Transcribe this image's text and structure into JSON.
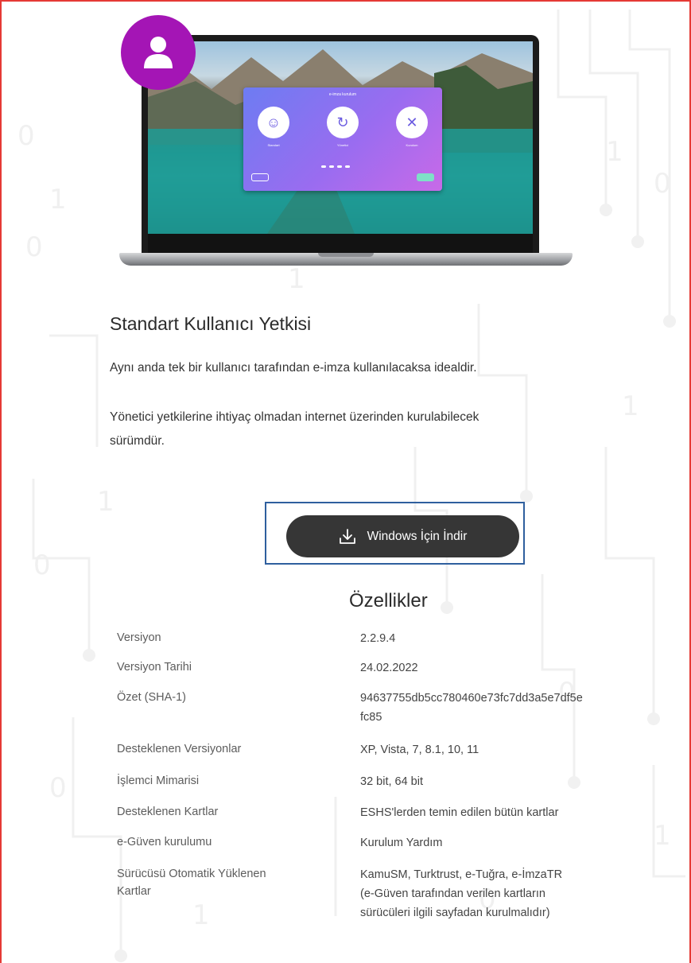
{
  "hero": {
    "avatar_icon": "user-icon",
    "app_window_title": "e-imza kurulum",
    "app_cards": [
      "Standart",
      "Yönetici",
      "Kurulum"
    ]
  },
  "section": {
    "title": "Standart Kullanıcı Yetkisi",
    "paragraph_1": "Aynı anda tek bir kullanıcı tarafından e-imza kullanılacaksa idealdir.",
    "paragraph_2_line_1": "Yönetici yetkilerine ihtiyaç olmadan internet üzerinden kurulabilecek",
    "paragraph_2_line_2": "sürümdür."
  },
  "download": {
    "icon": "download-icon",
    "label": "Windows İçin İndir"
  },
  "features": {
    "title": "Özellikler",
    "rows": [
      {
        "label": "Versiyon",
        "value": "2.2.9.4"
      },
      {
        "label": "Versiyon Tarihi",
        "value": "24.02.2022"
      },
      {
        "label": "Özet (SHA-1)",
        "value": "94637755db5cc780460e73fc7dd3a5e7df5e",
        "value_2": "fc85"
      },
      {
        "label": "Desteklenen Versiyonlar",
        "value": "XP, Vista, 7, 8.1, 10, 11"
      },
      {
        "label": "İşlemci Mimarisi",
        "value": "32 bit, 64 bit"
      },
      {
        "label": "Desteklenen Kartlar",
        "value": "ESHS'lerden temin edilen bütün kartlar"
      },
      {
        "label": "e-Güven kurulumu",
        "value": "Kurulum Yardım"
      },
      {
        "label": "Sürücüsü Otomatik Yüklenen",
        "label_2": "Kartlar",
        "value": "KamuSM, Turktrust, e-Tuğra, e-İmzaTR",
        "value_2": "(e-Güven tarafından verilen kartların",
        "value_3": "sürücüleri ilgili sayfadan kurulmalıdır)"
      }
    ]
  },
  "colors": {
    "frame_border": "#e53935",
    "avatar_bg": "#a415b5",
    "button_bg": "#363636",
    "focus_outline": "#2f5f9e"
  }
}
